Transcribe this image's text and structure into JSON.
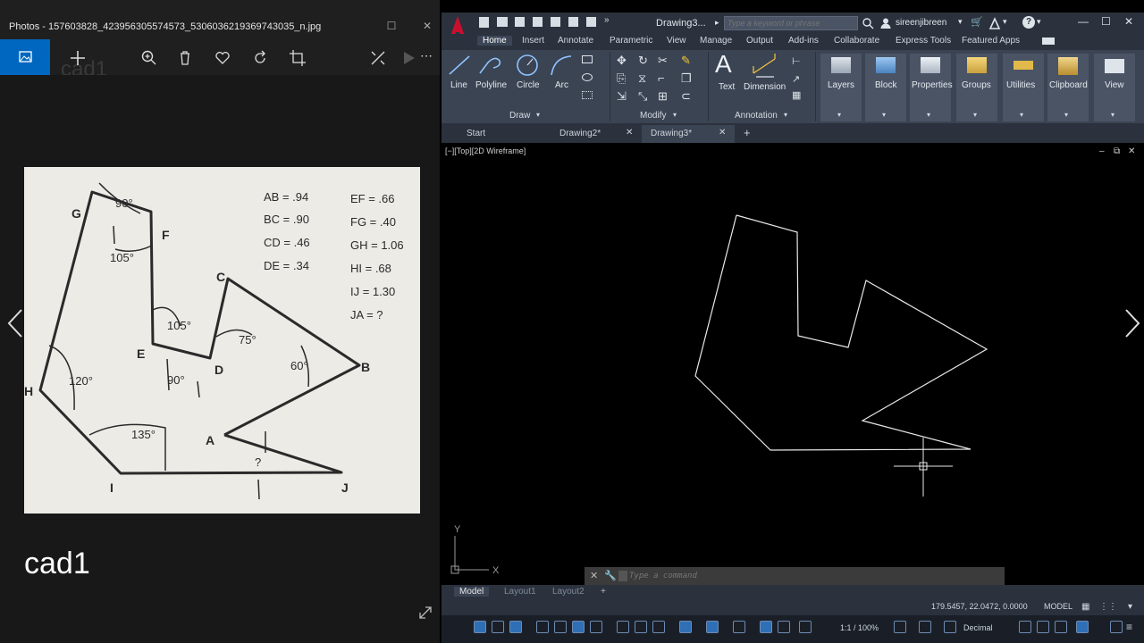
{
  "photos": {
    "title": "Photos - 157603828_423956305574573_5306036219369743035_n.jpg",
    "ghost_name": "cad1",
    "caption": "cad1",
    "scan": {
      "vertices": [
        "A",
        "B",
        "C",
        "D",
        "E",
        "F",
        "G",
        "H",
        "I",
        "J"
      ],
      "angles": [
        "90°",
        "105°",
        "105°",
        "75°",
        "60°",
        "90°",
        "120°",
        "135°",
        "?"
      ],
      "lengths": [
        "AB = .94",
        "BC = .90",
        "CD = .46",
        "DE = .34",
        "EF = .66",
        "FG = .40",
        "GH = 1.06",
        "HI = .68",
        "IJ = 1.30",
        "JA = ?"
      ]
    }
  },
  "acad": {
    "title": "Drawing3...",
    "search_placeholder": "Type a keyword or phrase",
    "user": "sireenjibreen",
    "ribbon_tabs": [
      "Home",
      "Insert",
      "Annotate",
      "Parametric",
      "View",
      "Manage",
      "Output",
      "Add-ins",
      "Collaborate",
      "Express Tools",
      "Featured Apps"
    ],
    "draw_tools": [
      "Line",
      "Polyline",
      "Circle",
      "Arc"
    ],
    "panel_titles": [
      "Draw",
      "Modify",
      "Annotation"
    ],
    "annotation_tools": [
      "Text",
      "Dimension"
    ],
    "big_panels": [
      "Layers",
      "Block",
      "Properties",
      "Groups",
      "Utilities",
      "Clipboard",
      "View"
    ],
    "file_tabs": [
      "Start",
      "Drawing2*",
      "Drawing3*"
    ],
    "viewport_label": "[−][Top][2D Wireframe]",
    "command_placeholder": "Type a command",
    "layout_tabs": [
      "Model",
      "Layout1",
      "Layout2"
    ],
    "coords": "179.5457, 22.0472, 0.0000",
    "status_model": "MODEL",
    "scale": "1:1 / 100%",
    "units": "Decimal",
    "ucs_x": "X",
    "ucs_y": "Y"
  },
  "colors": {
    "accent": "#0067c0",
    "acad_red": "#c8102e",
    "ribbon": "#3b4453"
  }
}
